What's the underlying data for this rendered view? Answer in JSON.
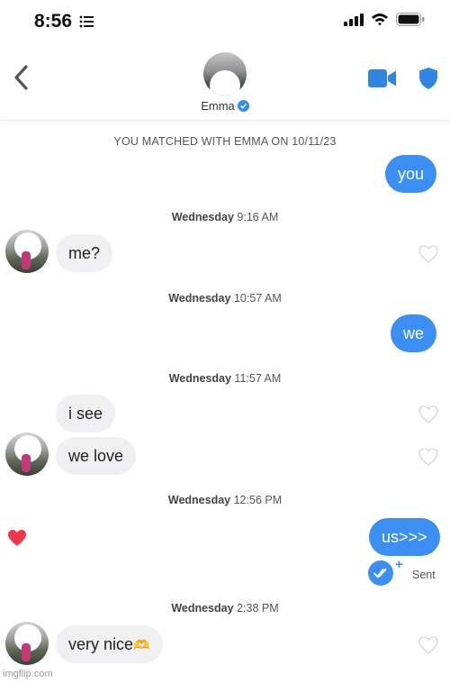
{
  "status_bar": {
    "time": "8:56"
  },
  "header": {
    "name": "Emma"
  },
  "chat": {
    "match_notice": "YOU MATCHED WITH EMMA ON 10/11/23",
    "messages": {
      "m1": "you",
      "m2": "me?",
      "m3": "we",
      "m4": "i see",
      "m5": "we love",
      "m6": "us>>>",
      "m7": "very nice"
    },
    "timestamps": {
      "t1": {
        "day": "Wednesday",
        "time": "9:16 AM"
      },
      "t2": {
        "day": "Wednesday",
        "time": "10:57 AM"
      },
      "t3": {
        "day": "Wednesday",
        "time": "11:57 AM"
      },
      "t4": {
        "day": "Wednesday",
        "time": "12:56 PM"
      },
      "t5": {
        "day": "Wednesday",
        "time": "2:38 PM"
      }
    },
    "sent_status": "Sent",
    "emoji_m7": "🫶"
  },
  "watermark": "imgflip.com",
  "colors": {
    "accent_blue": "#3b8ff3",
    "liked_heart": "#f0364a",
    "bubble_in": "#f0f0f2"
  },
  "icons": [
    "back-chevron-icon",
    "video-call-icon",
    "shield-icon",
    "verified-badge-icon",
    "heart-icon",
    "read-receipt-icon"
  ]
}
